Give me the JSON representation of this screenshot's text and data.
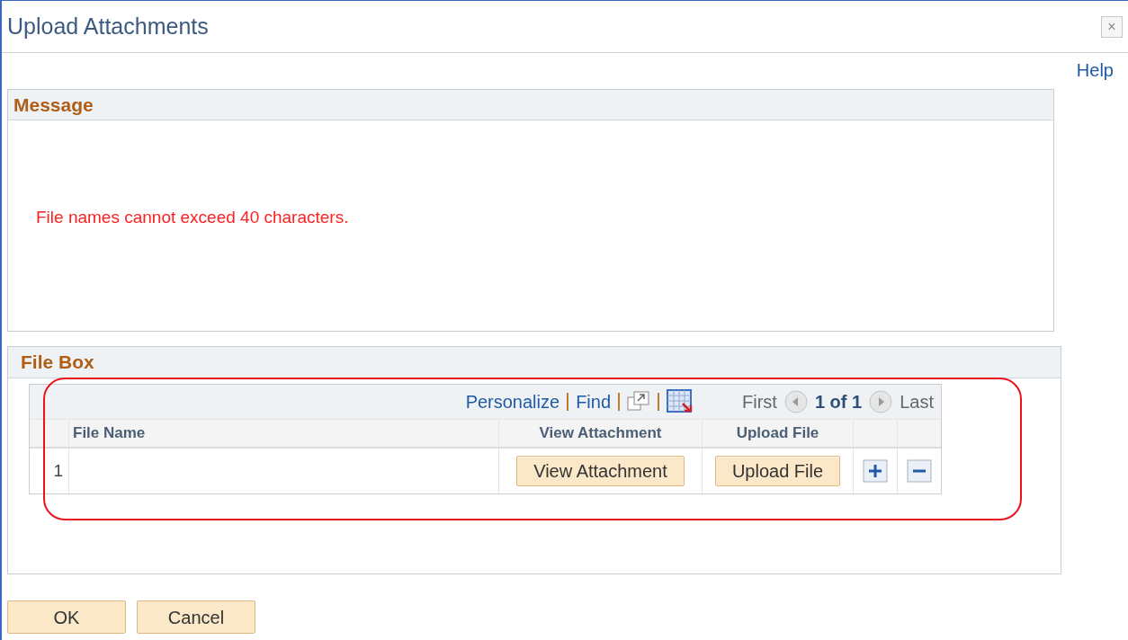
{
  "window": {
    "title": "Upload Attachments",
    "close": "×"
  },
  "help_link": "Help",
  "message_section": {
    "title": "Message",
    "text": "File names cannot exceed 40 characters."
  },
  "file_box": {
    "title": "File Box",
    "highlighted": true,
    "toolbar": {
      "personalize": "Personalize",
      "find": "Find",
      "first": "First",
      "page": "1 of 1",
      "last": "Last"
    },
    "columns": [
      "File Name",
      "View Attachment",
      "Upload File"
    ],
    "rows": [
      {
        "row_number": "1",
        "file_name": "",
        "view_button": "View Attachment",
        "upload_button": "Upload File"
      }
    ]
  },
  "buttons": [
    "OK",
    "Cancel"
  ]
}
